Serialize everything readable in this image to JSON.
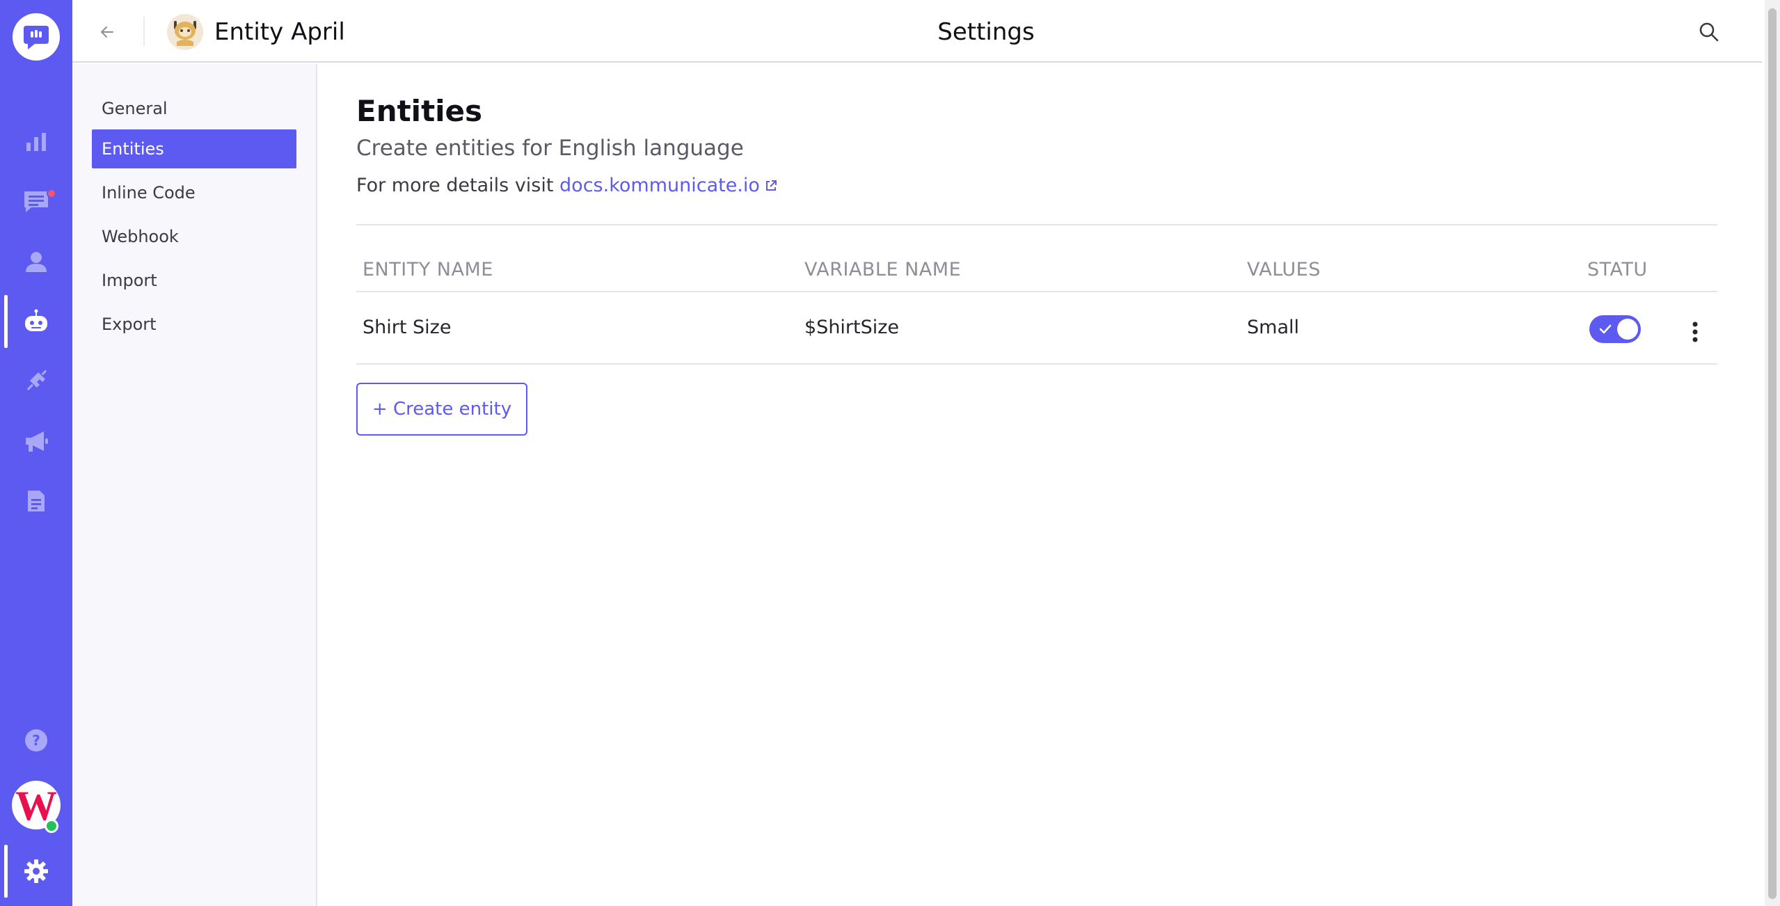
{
  "app": {
    "accent_color": "#5c5af0",
    "alert_color": "#f3566b",
    "online_color": "#21c25a"
  },
  "rail": {
    "logo_icon": "chat-bubble-logo-icon",
    "items": [
      {
        "icon": "bar-chart-icon",
        "name": "analytics"
      },
      {
        "icon": "conversations-icon",
        "name": "conversations",
        "has_badge": true
      },
      {
        "icon": "users-icon",
        "name": "users"
      },
      {
        "icon": "bot-icon",
        "name": "bot-integrations",
        "active": true
      },
      {
        "icon": "integrations-icon",
        "name": "integrations"
      },
      {
        "icon": "megaphone-icon",
        "name": "campaigns"
      },
      {
        "icon": "document-icon",
        "name": "reports"
      },
      {
        "icon": "help-icon",
        "name": "help"
      },
      {
        "icon": "gear-icon",
        "name": "settings",
        "active": true
      }
    ],
    "avatar_letter": "W",
    "avatar_status": "online"
  },
  "header": {
    "bot_name": "Entity April",
    "title": "Settings"
  },
  "sidebar": {
    "items": [
      {
        "label": "General",
        "active": false
      },
      {
        "label": "Entities",
        "active": true
      },
      {
        "label": "Inline Code",
        "active": false
      },
      {
        "label": "Webhook",
        "active": false
      },
      {
        "label": "Import",
        "active": false
      },
      {
        "label": "Export",
        "active": false
      }
    ]
  },
  "main": {
    "heading": "Entities",
    "subheading": "Create entities for English language",
    "details_prefix": "For more details visit ",
    "docs_link": "docs.kommunicate.io",
    "table": {
      "columns": [
        "ENTITY NAME",
        "VARIABLE NAME",
        "VALUES",
        "STATU"
      ],
      "rows": [
        {
          "entity_name": "Shirt Size",
          "variable_name": "$ShirtSize",
          "values": "Small",
          "status_enabled": true
        }
      ]
    },
    "create_button": "+ Create entity"
  }
}
